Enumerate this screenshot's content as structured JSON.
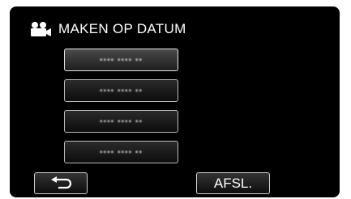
{
  "header": {
    "icon": "video-camera-icon",
    "title": "MAKEN OP DATUM"
  },
  "date_list": [
    {
      "label": "▪▪▪▪ ▪▪▪▪ ▪▪",
      "selected": true
    },
    {
      "label": "▪▪▪▪ ▪▪▪▪ ▪▪",
      "selected": false
    },
    {
      "label": "▪▪▪▪ ▪▪▪▪ ▪▪",
      "selected": false
    },
    {
      "label": "▪▪▪▪ ▪▪▪▪ ▪▪",
      "selected": false
    }
  ],
  "footer": {
    "back_icon": "return-arrow-icon",
    "end_label": "AFSL."
  },
  "colors": {
    "screen_background": "#000000",
    "text": "#ffffff",
    "button_border": "#d0d0d0"
  }
}
